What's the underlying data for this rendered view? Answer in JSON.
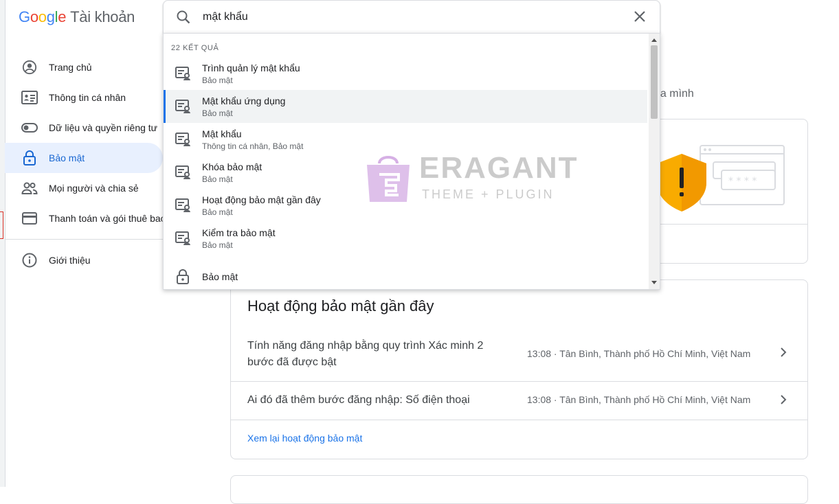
{
  "app": {
    "logo_word": [
      "G",
      "o",
      "o",
      "g",
      "l",
      "e"
    ],
    "product": "Tài khoản"
  },
  "search": {
    "value": "mật khẩu"
  },
  "results": {
    "count_label": "22 KẾT QUẢ",
    "items": [
      {
        "title": "Trình quản lý mật khẩu",
        "subtitle": "Bảo mật",
        "icon": "settings-result-icon"
      },
      {
        "title": "Mật khẩu ứng dụng",
        "subtitle": "Bảo mật",
        "icon": "settings-result-icon"
      },
      {
        "title": "Mật khẩu",
        "subtitle": "Thông tin cá nhân, Bảo mật",
        "icon": "settings-result-icon"
      },
      {
        "title": "Khóa bảo mật",
        "subtitle": "Bảo mật",
        "icon": "settings-result-icon"
      },
      {
        "title": "Hoạt động bảo mật gần đây",
        "subtitle": "Bảo mật",
        "icon": "settings-result-icon"
      },
      {
        "title": "Kiểm tra bảo mật",
        "subtitle": "Bảo mật",
        "icon": "settings-result-icon"
      },
      {
        "title": "Bảo mật",
        "subtitle": "",
        "icon": "lock-icon"
      }
    ]
  },
  "sidebar": {
    "items": [
      {
        "label": "Trang chủ",
        "icon": "account-circle-icon"
      },
      {
        "label": "Thông tin cá nhân",
        "icon": "id-card-icon"
      },
      {
        "label": "Dữ liệu và quyền riêng tư",
        "icon": "toggle-icon"
      },
      {
        "label": "Bảo mật",
        "icon": "lock-icon",
        "active": true
      },
      {
        "label": "Mọi người và chia sẻ",
        "icon": "people-icon"
      },
      {
        "label": "Thanh toán và gói thuê bao",
        "icon": "credit-card-icon"
      },
      {
        "label": "Giới thiệu",
        "icon": "info-icon"
      }
    ]
  },
  "main": {
    "partial_text": "ủa mình",
    "activity": {
      "title": "Hoạt động bảo mật gần đây",
      "rows": [
        {
          "description": "Tính năng đăng nhập bằng quy trình Xác minh 2 bước đã được bật",
          "meta": "13:08 · Tân Bình, Thành phố Hồ Chí Minh, Việt Nam"
        },
        {
          "description": "Ai đó đã thêm bước đăng nhập: Số điện thoại",
          "meta": "13:08 · Tân Bình, Thành phố Hồ Chí Minh, Việt Nam"
        }
      ],
      "review_link": "Xem lại hoạt động bảo mật"
    }
  },
  "watermark": {
    "brand": "ERAGANT",
    "tagline": "THEME + PLUGIN"
  },
  "colors": {
    "accent": "#1a73e8",
    "active_bg": "#e8f0fe",
    "warning": "#f9ab00"
  }
}
